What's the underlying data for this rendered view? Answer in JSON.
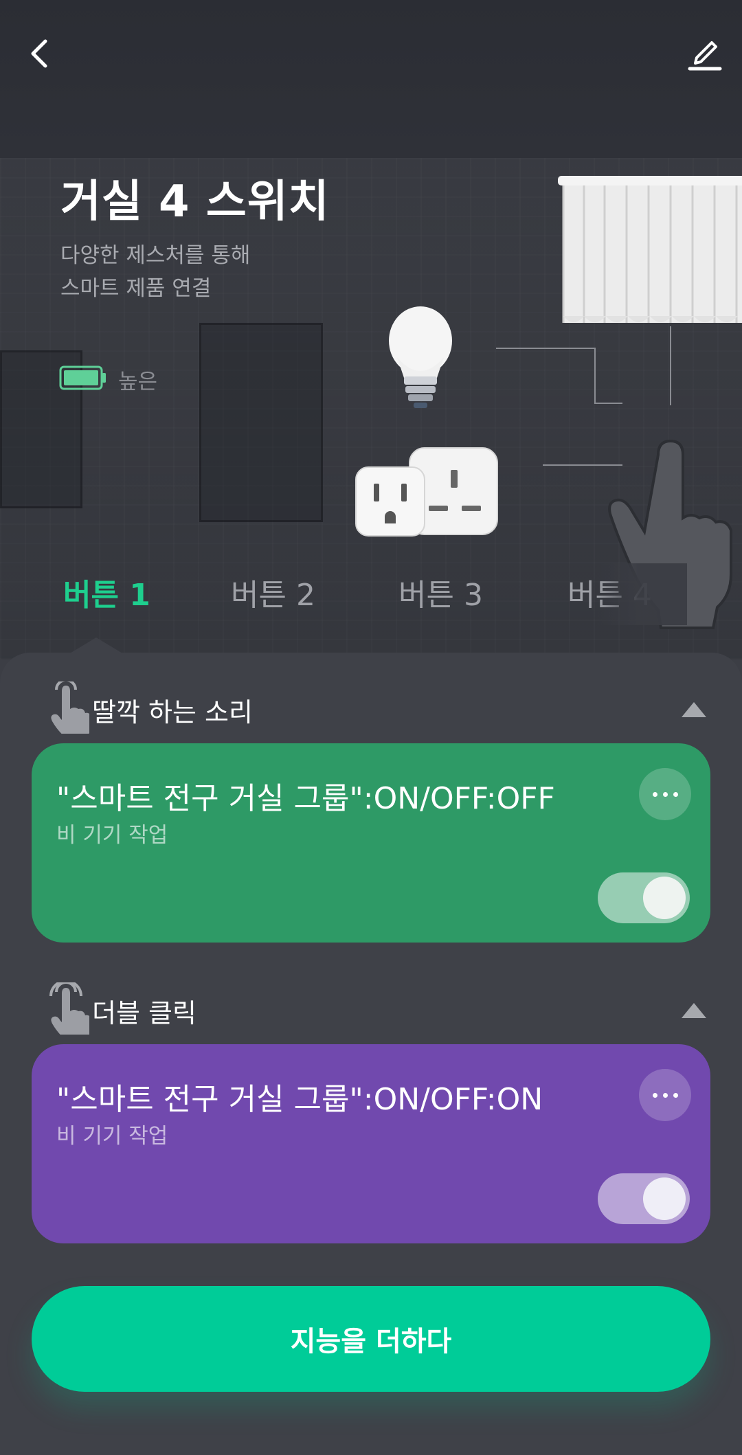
{
  "header": {
    "title": "거실 4 스위치",
    "subtitle_line1": "다양한 제스처를 통해",
    "subtitle_line2": "스마트 제품 연결",
    "battery_label": "높은",
    "battery_level": 1.0
  },
  "icons": {
    "back": "back-chevron-icon",
    "edit": "pencil-icon",
    "battery": "battery-icon",
    "single_tap": "single-tap-hand-icon",
    "double_tap": "double-tap-hand-icon",
    "collapse": "triangle-up-icon",
    "more": "more-dots-icon"
  },
  "tabs": [
    {
      "label": "버튼 1",
      "active": true
    },
    {
      "label": "버튼 2",
      "active": false
    },
    {
      "label": "버튼 3",
      "active": false
    },
    {
      "label": "버튼 4",
      "active": false
    }
  ],
  "sections": [
    {
      "title": "딸깍 하는 소리",
      "card": {
        "title": "\"스마트 전구 거실 그룹\":ON/OFF:OFF",
        "subtitle": "비 기기 작업",
        "enabled": true,
        "color": "#2e9a66"
      }
    },
    {
      "title": "더블 클릭",
      "card": {
        "title": "\"스마트 전구 거실 그룹\":ON/OFF:ON",
        "subtitle": "비 기기 작업",
        "enabled": true,
        "color": "#7149ae"
      }
    }
  ],
  "cta": {
    "label": "지능을 더하다",
    "color": "#00cc98"
  },
  "colors": {
    "accent": "#1ecf8e",
    "background": "#3f4148",
    "battery": "#5fd098"
  }
}
